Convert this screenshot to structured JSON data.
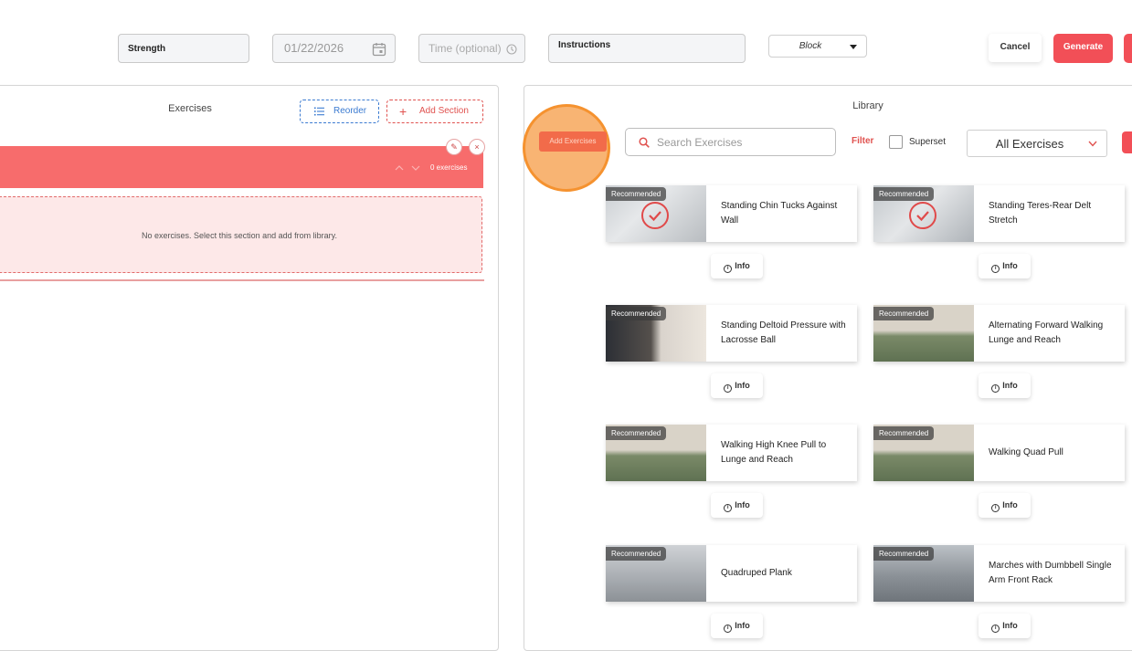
{
  "toolbar": {
    "type_value": "Strength",
    "date_value": "01/22/2026",
    "time_placeholder": "Time (optional)",
    "instructions_label": "Instructions",
    "block_value": "Block",
    "cancel_label": "Cancel",
    "generate_label": "Generate"
  },
  "exercises_panel": {
    "title": "Exercises",
    "reorder_label": "Reorder",
    "add_section_label": "Add Section",
    "section": {
      "count_label": "0 exercises",
      "empty_text": "No exercises. Select this section and add from library."
    }
  },
  "library": {
    "title": "Library",
    "add_exercises_label": "Add Exercises",
    "search_placeholder": "Search Exercises",
    "filter_label": "Filter",
    "superset_label": "Superset",
    "category_value": "All Exercises",
    "badge_text": "Recommended",
    "info_label": "Info",
    "cards": [
      {
        "title": "Standing Chin Tucks Against Wall"
      },
      {
        "title": "Standing Teres-Rear Delt Stretch"
      },
      {
        "title": "Standing Deltoid Pressure with Lacrosse Ball"
      },
      {
        "title": "Alternating Forward Walking Lunge and Reach"
      },
      {
        "title": "Walking High Knee Pull to Lunge and Reach"
      },
      {
        "title": "Walking Quad Pull"
      },
      {
        "title": "Quadruped Plank"
      },
      {
        "title": "Marches with Dumbbell Single Arm Front Rack"
      }
    ]
  },
  "colors": {
    "accent": "#f24f57",
    "section_header": "#f76c6c",
    "reorder_blue": "#3b7bd1",
    "highlight_orange": "#f5922f"
  }
}
